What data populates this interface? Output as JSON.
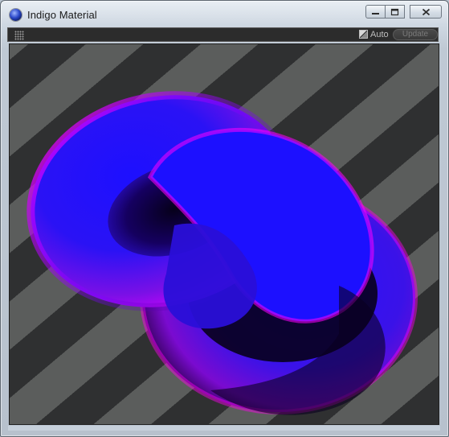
{
  "window": {
    "title": "Indigo Material",
    "icon": "indigo-sphere-icon"
  },
  "caption_buttons": {
    "minimize_icon": "minimize-icon",
    "maximize_icon": "maximize-icon",
    "close_icon": "close-icon"
  },
  "toolbar": {
    "grip_icon": "grip-icon",
    "auto_checked": true,
    "auto_label": "Auto",
    "update_label": "Update",
    "update_enabled": false
  },
  "preview": {
    "subject": "knot-render",
    "colors": {
      "primary": "#1a10ff",
      "highlight": "#e100ff",
      "shadow": "#05001a",
      "stripe_dark": "#2f3031",
      "stripe_light": "#5b5d5c"
    }
  }
}
